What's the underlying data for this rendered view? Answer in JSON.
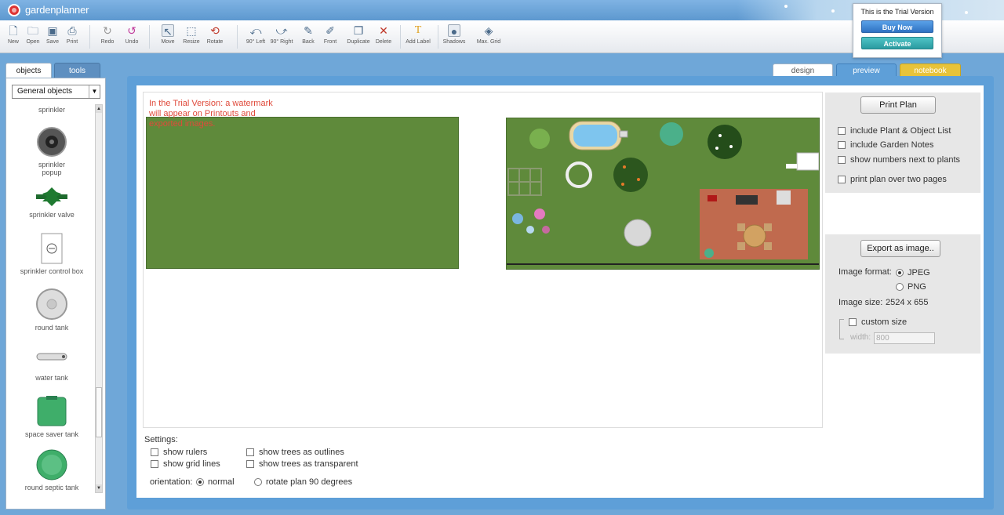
{
  "app": {
    "name": "gardenplanner"
  },
  "toolbar": {
    "new": "New",
    "open": "Open",
    "save": "Save",
    "print": "Print",
    "redo": "Redo",
    "undo": "Undo",
    "move": "Move",
    "resize": "Resize",
    "rotate": "Rotate",
    "rot_left": "90° Left",
    "rot_right": "90° Right",
    "back": "Back",
    "front": "Front",
    "duplicate": "Duplicate",
    "delete": "Delete",
    "add_label": "Add Label",
    "shadows": "Shadows",
    "max_grid": "Max. Grid"
  },
  "trial": {
    "text": "This is the Trial Version",
    "buy": "Buy Now",
    "activate": "Activate"
  },
  "left": {
    "tab_objects": "objects",
    "tab_tools": "tools",
    "category": "General objects",
    "items": [
      {
        "label": "sprinkler"
      },
      {
        "label": "sprinkler popup"
      },
      {
        "label": "sprinkler valve"
      },
      {
        "label": "sprinkler control box"
      },
      {
        "label": "round tank"
      },
      {
        "label": "water tank"
      },
      {
        "label": "space saver tank"
      },
      {
        "label": "round septic tank"
      }
    ]
  },
  "tabs": {
    "design": "design",
    "preview": "preview",
    "notebook": "notebook"
  },
  "preview": {
    "watermark": "In the Trial Version: a watermark will appear on Printouts and exported images."
  },
  "settings": {
    "label": "Settings:",
    "show_rulers": "show rulers",
    "show_grid": "show grid lines",
    "trees_outlines": "show trees as outlines",
    "trees_transparent": "show trees as transparent",
    "orientation_label": "orientation:",
    "normal": "normal",
    "rotate": "rotate plan 90 degrees"
  },
  "print": {
    "button": "Print Plan",
    "include_list": "include Plant & Object List",
    "include_notes": "include Garden Notes",
    "show_numbers": "show numbers next to plants",
    "two_pages": "print plan over two pages"
  },
  "export": {
    "button": "Export as image..",
    "format_label": "Image format:",
    "jpeg": "JPEG",
    "png": "PNG",
    "size_label": "Image size:",
    "size_value": "2524 x 655",
    "custom_size": "custom size",
    "width_label": "width:",
    "width_value": "800"
  },
  "colors": {
    "frame": "#5e9fd8",
    "lawn": "#5f8a3b",
    "watermark": "#e04a3b",
    "notebook": "#e8c33a"
  }
}
